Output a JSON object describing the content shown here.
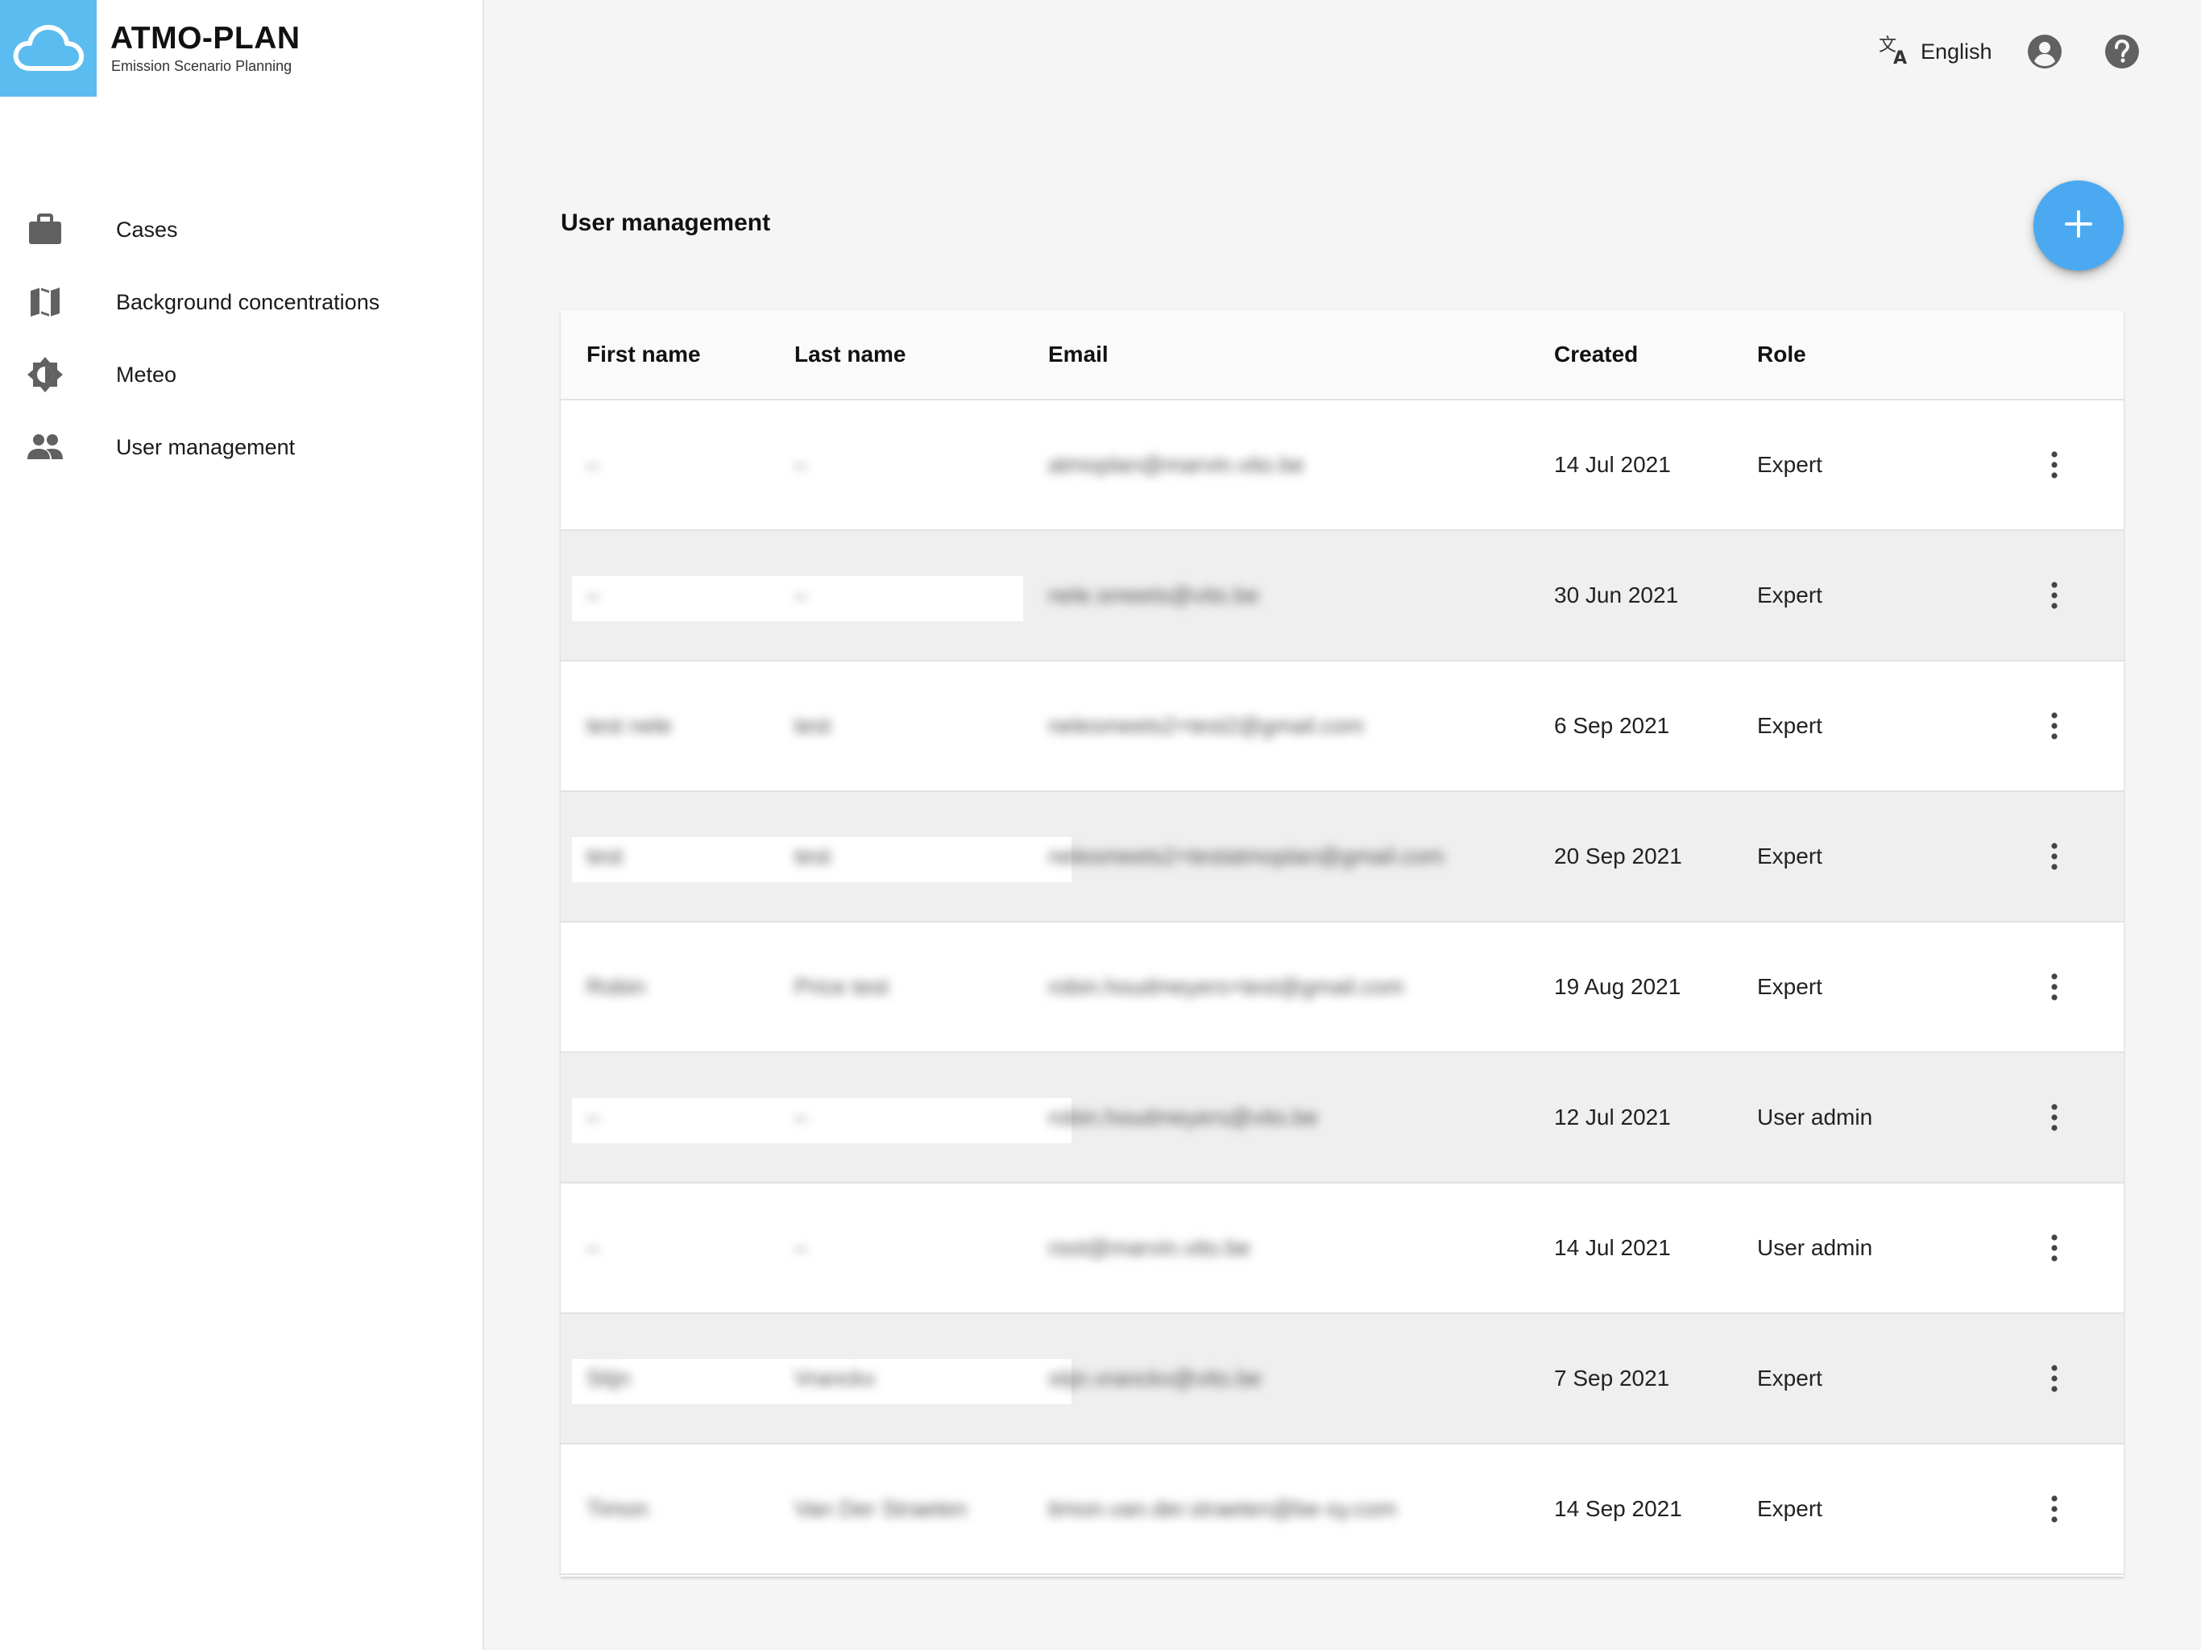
{
  "brand": {
    "name": "ATMO-PLAN",
    "subtitle": "Emission Scenario Planning"
  },
  "sidebar": {
    "items": [
      {
        "label": "Cases",
        "icon": "briefcase-icon"
      },
      {
        "label": "Background concentrations",
        "icon": "map-icon"
      },
      {
        "label": "Meteo",
        "icon": "brightness-icon"
      },
      {
        "label": "User management",
        "icon": "people-icon"
      }
    ]
  },
  "topbar": {
    "language": "English",
    "language_icon": "translate-icon",
    "account_icon": "account-circle-icon",
    "help_icon": "help-icon"
  },
  "main": {
    "title": "User management",
    "add_button_icon": "plus-icon"
  },
  "table": {
    "columns": [
      "First name",
      "Last name",
      "Email",
      "Created",
      "Role"
    ],
    "rows": [
      {
        "first": "–",
        "last": "–",
        "email": "atmoplan@marvin.vito.be",
        "created": "14 Jul 2021",
        "role": "Expert"
      },
      {
        "first": "–",
        "last": "–",
        "email": "nele.smeets@vito.be",
        "created": "30 Jun 2021",
        "role": "Expert"
      },
      {
        "first": "test nele",
        "last": "test",
        "email": "nelesmeets2+test2@gmail.com",
        "created": "6 Sep 2021",
        "role": "Expert"
      },
      {
        "first": "test",
        "last": "test",
        "email": "nelesmeets2+testatmoplan@gmail.com",
        "created": "20 Sep 2021",
        "role": "Expert"
      },
      {
        "first": "Robin",
        "last": "Price test",
        "email": "robin.houdmeyers+test@gmail.com",
        "created": "19 Aug 2021",
        "role": "Expert"
      },
      {
        "first": "–",
        "last": "–",
        "email": "robin.houdmeyers@vito.be",
        "created": "12 Jul 2021",
        "role": "User admin"
      },
      {
        "first": "–",
        "last": "–",
        "email": "root@marvin.vito.be",
        "created": "14 Jul 2021",
        "role": "User admin"
      },
      {
        "first": "Stijn",
        "last": "Vranckx",
        "email": "stijn.vranckx@vito.be",
        "created": "7 Sep 2021",
        "role": "Expert"
      },
      {
        "first": "Timon",
        "last": "Van Der Straeten",
        "email": "timon.van.der.straeten@be-sy.com",
        "created": "14 Sep 2021",
        "role": "Expert"
      }
    ]
  },
  "colors": {
    "brand": "#5bbcf0",
    "fab": "#4ba9f2",
    "icon_gray": "#616161"
  }
}
